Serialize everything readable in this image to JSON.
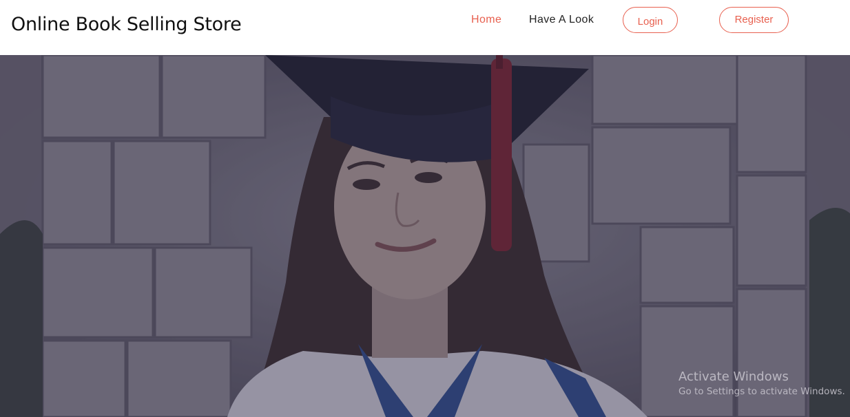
{
  "header": {
    "brand": "Online Book Selling Store",
    "nav": {
      "home": "Home",
      "have_a_look": "Have A Look"
    },
    "buttons": {
      "login": "Login",
      "register": "Register"
    }
  },
  "colors": {
    "accent": "#e8604f",
    "overlay": "#2b2a46"
  },
  "hero": {
    "image": "graduate-portrait-photo"
  },
  "watermark": {
    "title": "Activate Windows",
    "subtitle": "Go to Settings to activate Windows."
  }
}
